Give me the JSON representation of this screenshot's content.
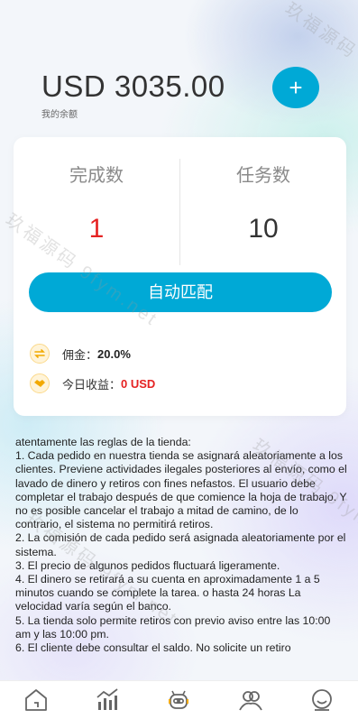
{
  "balance": {
    "amount": "USD 3035.00",
    "label": "我的余额"
  },
  "add_button": {
    "label": "+"
  },
  "stats": {
    "completed_label": "完成数",
    "completed_value": "1",
    "tasks_label": "任务数",
    "tasks_value": "10"
  },
  "match_button": {
    "label": "自动匹配"
  },
  "info": {
    "commission_label": "佣金：",
    "commission_value": "20.0%",
    "today_label": "今日收益：",
    "today_value": "0 USD"
  },
  "rules_text": " atentamente las reglas de la tienda:\n1. Cada pedido en nuestra tienda se asignará aleatoriamente a los clientes. Previene actividades ilegales posteriores al envío, como el lavado de dinero y retiros con fines nefastos. El usuario debe completar el trabajo después de que comience la hoja de trabajo. Y no es posible cancelar el trabajo a mitad de camino, de lo contrario, el sistema no permitirá retiros.\n2. La comisión de cada pedido será asignada aleatoriamente por el sistema.\n3. El precio de algunos pedidos fluctuará ligeramente.\n4. El dinero se retirará a su cuenta en aproximadamente 1 a 5 minutos cuando se complete la tarea. o hasta 24 horas La velocidad varía según el banco.\n5. La tienda solo permite retiros con previo aviso entre las 10:00 am y las 10:00 pm.\n6. El cliente debe consultar el saldo. No solicite un retiro",
  "tabbar": {
    "items": [
      {
        "icon": "home-icon"
      },
      {
        "icon": "chart-icon"
      },
      {
        "icon": "robot-icon"
      },
      {
        "icon": "team-icon"
      },
      {
        "icon": "profile-icon"
      }
    ]
  },
  "watermarks": [
    "玖福源码 9fym.net",
    "玖福源码 9fym.net",
    "玖福源码 9fym.net",
    "玖福源码 9fym.net"
  ],
  "colors": {
    "accent": "#00a9d6",
    "red": "#e52222",
    "gold": "#f2a900"
  }
}
